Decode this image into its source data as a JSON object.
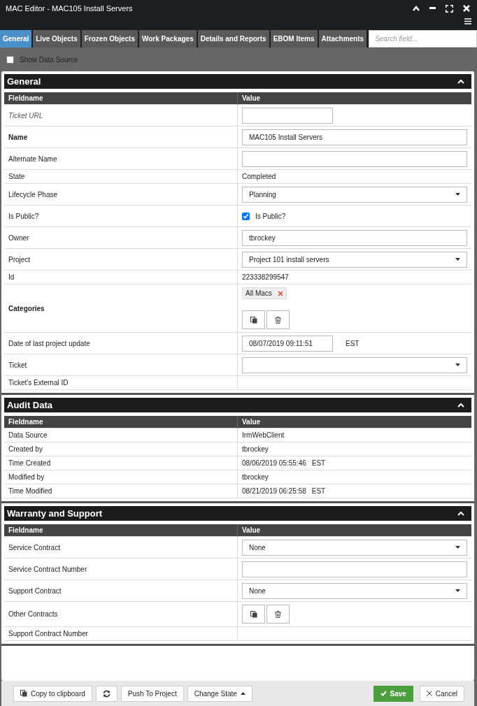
{
  "window": {
    "title": "MAC Editor - MAC105 Install Servers"
  },
  "tabs": [
    {
      "label": "General",
      "selected": true
    },
    {
      "label": "Live Objects",
      "selected": false
    },
    {
      "label": "Frozen Objects",
      "selected": false
    },
    {
      "label": "Work Packages",
      "selected": false
    },
    {
      "label": "Details and Reports",
      "selected": false
    },
    {
      "label": "EBOM Items",
      "selected": false
    },
    {
      "label": "Attachments",
      "selected": false
    }
  ],
  "search": {
    "placeholder": "Search field..."
  },
  "show_data_source": {
    "label": "Show Data Source",
    "checked": false
  },
  "sections": [
    {
      "title": "General",
      "expanded": true,
      "columns": [
        "Fieldname",
        "Value"
      ],
      "rows": [
        {
          "label": "Ticket URL",
          "link": true,
          "required": false,
          "kind": "short_field"
        },
        {
          "label": "Name",
          "link": false,
          "required": true,
          "kind": "field",
          "value": "MAC105 Install Servers"
        },
        {
          "label": "Alternate Name",
          "link": false,
          "required": false,
          "kind": "field"
        },
        {
          "label": "State",
          "link": false,
          "required": false,
          "kind": "text",
          "value": "Completed"
        },
        {
          "label": "Lifecycle Phase",
          "link": false,
          "required": false,
          "kind": "select",
          "value": "Planning"
        },
        {
          "label": "Is Public?",
          "link": false,
          "required": false,
          "kind": "checkbox",
          "checked": true,
          "value": "Is Public?"
        },
        {
          "label": "Owner",
          "link": false,
          "required": false,
          "kind": "field",
          "value": "tbrockey"
        },
        {
          "label": "Project",
          "link": false,
          "required": false,
          "kind": "select",
          "value": "Project 101 install servers"
        },
        {
          "label": "Id",
          "link": false,
          "required": false,
          "kind": "text",
          "value": "223338299547"
        },
        {
          "label": "Categories",
          "link": false,
          "required": true,
          "kind": "tags",
          "tags": [
            "All Macs"
          ]
        },
        {
          "label": "Date of last project update",
          "link": false,
          "required": false,
          "kind": "date",
          "value": "08/07/2019 09:11:51",
          "zone": "EST"
        },
        {
          "label": "Ticket",
          "link": false,
          "required": false,
          "kind": "select"
        },
        {
          "label": "Ticket's External ID",
          "link": false,
          "required": false,
          "kind": "text"
        }
      ]
    },
    {
      "title": "Audit Data",
      "expanded": true,
      "columns": [
        "Fieldname",
        "Value"
      ],
      "rows": [
        {
          "label": "Data Source",
          "link": false,
          "required": false,
          "kind": "text",
          "value": "IrmWebClient"
        },
        {
          "label": "Created by",
          "link": false,
          "required": false,
          "kind": "text",
          "value": "tbrockey"
        },
        {
          "label": "Time Created",
          "link": false,
          "required": false,
          "kind": "text",
          "value": "08/06/2019 05:55:46",
          "zone": "EST"
        },
        {
          "label": "Modified by",
          "link": false,
          "required": false,
          "kind": "text",
          "value": "tbrockey"
        },
        {
          "label": "Time Modified",
          "link": false,
          "required": false,
          "kind": "text",
          "value": "08/21/2019 06:25:58",
          "zone": "EST"
        }
      ]
    },
    {
      "title": "Warranty and Support",
      "expanded": true,
      "columns": [
        "Fieldname",
        "Value"
      ],
      "rows": [
        {
          "label": "Service Contract",
          "link": false,
          "required": false,
          "kind": "select",
          "value": "None"
        },
        {
          "label": "Service Contract Number",
          "link": false,
          "required": false,
          "kind": "field"
        },
        {
          "label": "Support Contract",
          "link": false,
          "required": false,
          "kind": "select",
          "value": "None"
        },
        {
          "label": "Other Contracts",
          "link": false,
          "required": false,
          "kind": "tags",
          "tags": []
        },
        {
          "label": "Support Contract Number",
          "link": false,
          "required": false,
          "kind": "text"
        }
      ]
    }
  ],
  "footer": {
    "copy": "Copy to clipboard",
    "push": "Push To Project",
    "change_state": "Change State",
    "save": "Save",
    "cancel": "Cancel"
  }
}
